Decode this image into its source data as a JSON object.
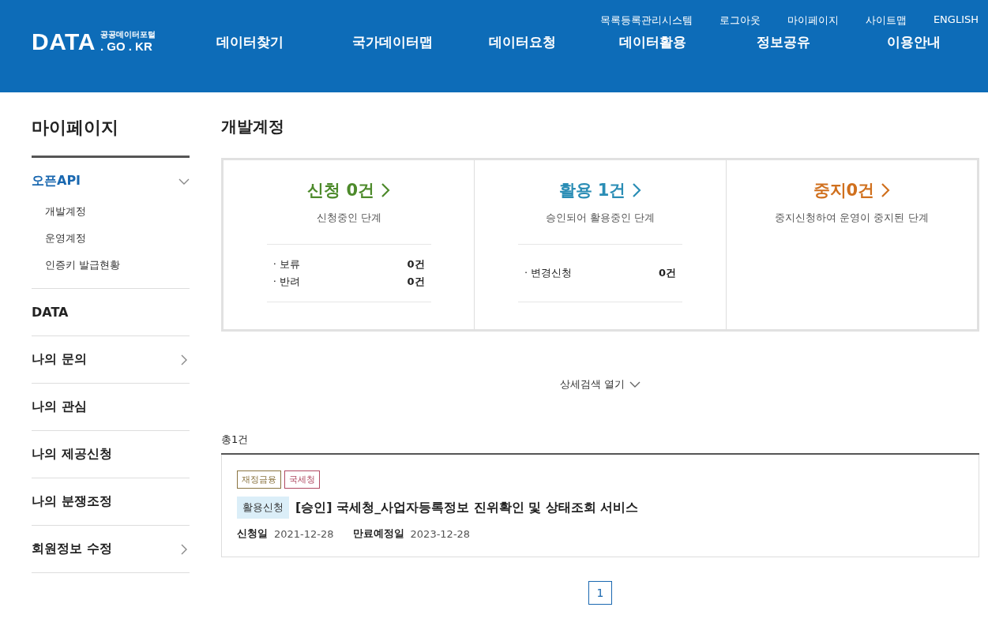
{
  "header": {
    "logo": {
      "main": "DATA",
      "sub": "공공데이터포털",
      "domain": ". GO . KR"
    },
    "util_links": [
      "목록등록관리시스템",
      "로그아웃",
      "마이페이지",
      "사이트맵",
      "ENGLISH"
    ],
    "nav": [
      "데이터찾기",
      "국가데이터맵",
      "데이터요청",
      "데이터활용",
      "정보공유",
      "이용안내"
    ]
  },
  "sidebar": {
    "title": "마이페이지",
    "items": [
      {
        "label": "오픈API",
        "kind": "collapsible",
        "expanded": true,
        "children": [
          {
            "label": "개발계정"
          },
          {
            "label": "운영계정"
          },
          {
            "label": "인증키 발급현황"
          }
        ]
      },
      {
        "label": "DATA",
        "kind": "link",
        "expanded": false
      },
      {
        "label": "나의 문의",
        "kind": "collapsible",
        "expanded": false
      },
      {
        "label": "나의 관심",
        "kind": "link",
        "expanded": false
      },
      {
        "label": "나의 제공신청",
        "kind": "link",
        "expanded": false
      },
      {
        "label": "나의 분쟁조정",
        "kind": "link",
        "expanded": false
      },
      {
        "label": "회원정보 수정",
        "kind": "collapsible",
        "expanded": false
      }
    ]
  },
  "page_title": "개발계정",
  "status_cards": [
    {
      "title": "신청 0건",
      "color": "#4d8a2b",
      "description": "신청중인 단계",
      "rows": [
        {
          "label": "· 보류",
          "count": "0건"
        },
        {
          "label": "· 반려",
          "count": "0건"
        }
      ]
    },
    {
      "title": "활용 1건",
      "color": "#2a8db5",
      "description": "승인되어 활용중인 단계",
      "rows": [
        {
          "label": "· 변경신청",
          "count": "0건"
        }
      ]
    },
    {
      "title": "중지0건",
      "color": "#d0701e",
      "description": "중지신청하여 운영이 중지된 단계"
    }
  ],
  "detail_search": {
    "label": "상세검색 열기",
    "expanded": false
  },
  "total": "총1건",
  "results": [
    {
      "tags": [
        {
          "label": "재정금융",
          "color": "#8a7440"
        },
        {
          "label": "국세청",
          "color": "#b04a62"
        }
      ],
      "badge": "활용신청",
      "title": "[승인] 국세청_사업자등록정보 진위확인 및 상태조회 서비스",
      "fields": [
        {
          "label": "신청일",
          "value": "2021-12-28"
        },
        {
          "label": "만료예정일",
          "value": "2023-12-28"
        }
      ]
    }
  ],
  "pagination": [
    {
      "label": "1",
      "selected": true
    }
  ]
}
